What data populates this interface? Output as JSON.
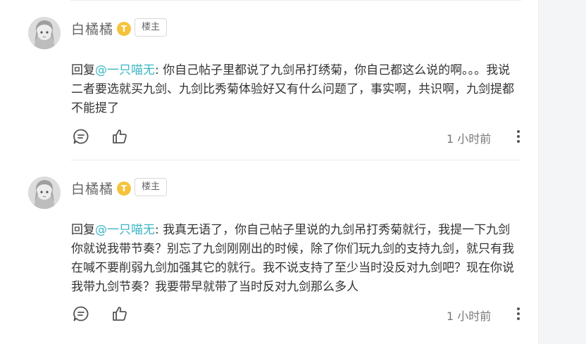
{
  "comments": [
    {
      "username": "白橘橘",
      "level_badge": "T",
      "op_badge": "楼主",
      "reply_prefix": "回复",
      "mention": "@一只喵无",
      "content": ": 你自己帖子里都说了九剑吊打绣菊，你自己都这么说的啊。。。我说二者要选就买九剑、九剑比秀菊体验好又有什么问题了，事实啊，共识啊，九剑提都不能提了",
      "time": "1 小时前",
      "icons": [
        "avatar",
        "reply-icon",
        "like-icon",
        "more-icon"
      ]
    },
    {
      "username": "白橘橘",
      "level_badge": "T",
      "op_badge": "楼主",
      "reply_prefix": "回复",
      "mention": "@一只喵无",
      "content": ": 我真无语了，你自己帖子里说的九剑吊打秀菊就行，我提一下九剑你就说我带节奏？别忘了九剑刚刚出的时候，除了你们玩九剑的支持九剑，就只有我在喊不要削弱九剑加强其它的就行。我不说支持了至少当时没反对九剑吧？现在你说我带九剑节奏？我要带早就带了当时反对九剑那么多人",
      "time": "1 小时前",
      "icons": [
        "avatar",
        "reply-icon",
        "like-icon",
        "more-icon"
      ]
    }
  ],
  "colors": {
    "mention": "#3bb6c4",
    "level_badge": "#f5c33b",
    "scroll_gutter": "#f4f5f7"
  }
}
